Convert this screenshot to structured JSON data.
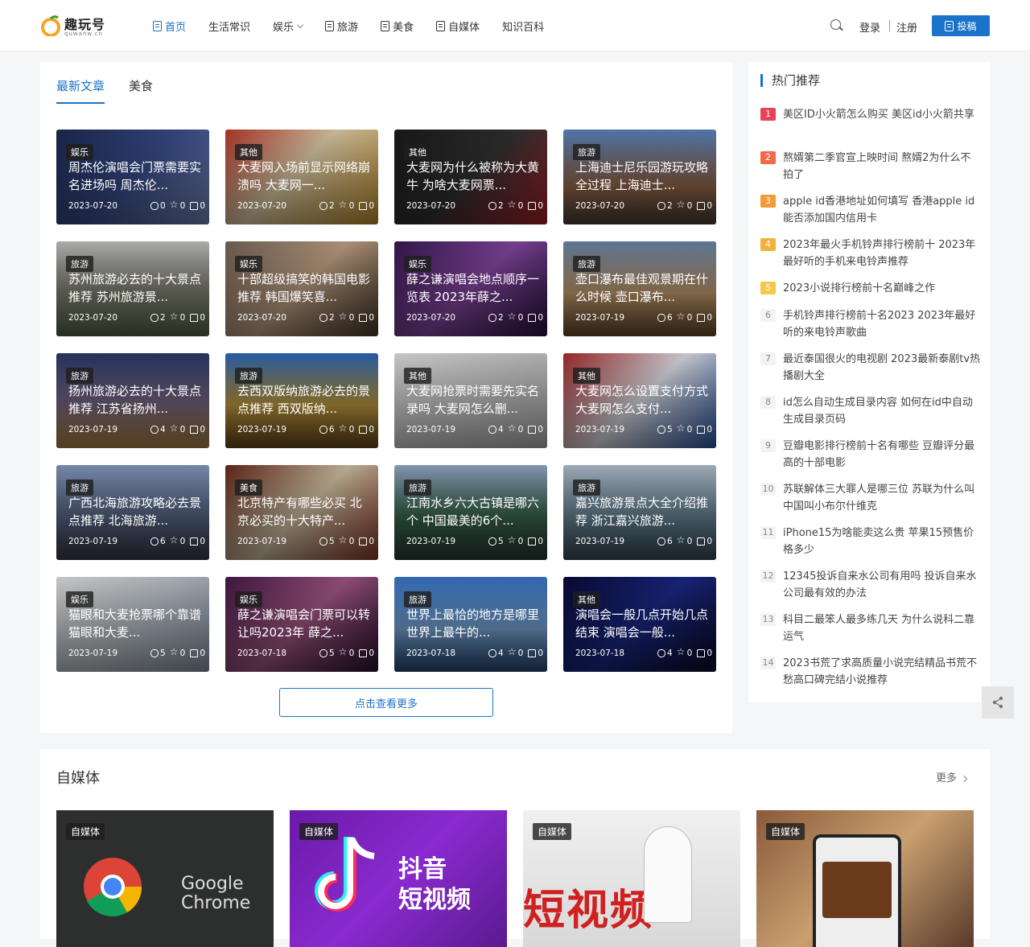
{
  "brand": {
    "name": "趣玩号",
    "domain": "quwanw.cn"
  },
  "nav": [
    {
      "label": "首页",
      "icon": "doc-icon",
      "active": true
    },
    {
      "label": "生活常识"
    },
    {
      "label": "娱乐",
      "dropdown": true
    },
    {
      "label": "旅游",
      "icon": "doc-icon"
    },
    {
      "label": "美食",
      "icon": "doc-icon"
    },
    {
      "label": "自媒体",
      "icon": "doc-icon"
    },
    {
      "label": "知识百科"
    }
  ],
  "header": {
    "login": "登录",
    "register": "注册",
    "post": "投稿"
  },
  "main": {
    "tabs": [
      "最新文章",
      "美食"
    ],
    "more_button": "点击查看更多",
    "cards": [
      {
        "cat": "娱乐",
        "title": "周杰伦演唱会门票需要实名进场吗 周杰伦...",
        "date": "2023-07-20",
        "views": "0",
        "stars": "0",
        "likes": "0",
        "bg": "linear-gradient(135deg,#1d2a55,#3a4f8f 50%,#7a8cc0)"
      },
      {
        "cat": "其他",
        "title": "大麦网入场前显示网络崩溃吗 大麦网一...",
        "date": "2023-07-20",
        "views": "2",
        "stars": "0",
        "likes": "0",
        "bg": "linear-gradient(135deg,#c23a2c,#e9d6b0 45%,#c5922e)"
      },
      {
        "cat": "其他",
        "title": "大麦网为什么被称为大黄牛 为啥大麦网票...",
        "date": "2023-07-20",
        "views": "2",
        "stars": "0",
        "likes": "0",
        "bg": "linear-gradient(135deg,#1b1b1b,#333 50%,#b1232c)"
      },
      {
        "cat": "旅游",
        "title": "上海迪士尼乐园游玩攻略全过程 上海迪士...",
        "date": "2023-07-20",
        "views": "2",
        "stars": "0",
        "likes": "0",
        "bg": "linear-gradient(180deg,#5a89c7,#9b6a4a 60%,#4a3e3a)"
      },
      {
        "cat": "旅游",
        "title": "苏州旅游必去的十大景点推荐 苏州旅游景...",
        "date": "2023-07-20",
        "views": "2",
        "stars": "0",
        "likes": "0",
        "bg": "linear-gradient(180deg,#c8c8c8,#8a8a7a 50%,#5a6a4a)"
      },
      {
        "cat": "娱乐",
        "title": "十部超级搞笑的韩国电影推荐 韩国爆笑喜...",
        "date": "2023-07-20",
        "views": "2",
        "stars": "0",
        "likes": "0",
        "bg": "linear-gradient(135deg,#7a6a5a,#c8a88a 50%,#4a3a2a)"
      },
      {
        "cat": "娱乐",
        "title": "薛之谦演唱会地点顺序一览表 2023年薛之...",
        "date": "2023-07-20",
        "views": "2",
        "stars": "0",
        "likes": "0",
        "bg": "linear-gradient(135deg,#3a1a55,#8a4aa8 50%,#2a1240)"
      },
      {
        "cat": "旅游",
        "title": "壶口瀑布最佳观景期在什么时候 壶口瀑布...",
        "date": "2023-07-19",
        "views": "6",
        "stars": "0",
        "likes": "0",
        "bg": "linear-gradient(180deg,#6a8ab0,#c8a070 55%,#6a4a2a)"
      },
      {
        "cat": "旅游",
        "title": "扬州旅游必去的十大景点推荐 江苏省扬州...",
        "date": "2023-07-19",
        "views": "4",
        "stars": "0",
        "likes": "0",
        "bg": "linear-gradient(180deg,#2a3a6a,#7a6a8a 50%,#b88a4a)"
      },
      {
        "cat": "旅游",
        "title": "去西双版纳旅游必去的景点推荐 西双版纳...",
        "date": "2023-07-19",
        "views": "6",
        "stars": "0",
        "likes": "0",
        "bg": "linear-gradient(180deg,#2a6ac0,#c8a040 55%,#6a4a1a)"
      },
      {
        "cat": "其他",
        "title": "大麦网抢票时需要先实名录吗 大麦网怎么删...",
        "date": "2023-07-19",
        "views": "4",
        "stars": "0",
        "likes": "0",
        "bg": "linear-gradient(135deg,#e8e8e8,#d0d0d0 50%,#b8b8b8)"
      },
      {
        "cat": "其他",
        "title": "大麦网怎么设置支付方式 大麦网怎么支付...",
        "date": "2023-07-19",
        "views": "5",
        "stars": "0",
        "likes": "0",
        "bg": "linear-gradient(135deg,#b02a2a,#e8e8f0 50%,#2a5aa8)"
      },
      {
        "cat": "旅游",
        "title": "广西北海旅游攻略必去景点推荐 北海旅游...",
        "date": "2023-07-19",
        "views": "6",
        "stars": "0",
        "likes": "0",
        "bg": "linear-gradient(180deg,#8aa0c8,#5a6a8a 55%,#3a3a4a)"
      },
      {
        "cat": "美食",
        "title": "北京特产有哪些必买 北京必买的十大特产...",
        "date": "2023-07-19",
        "views": "5",
        "stars": "0",
        "likes": "0",
        "bg": "linear-gradient(135deg,#6a2a1a,#d8c8a8 50%,#8a3a2a)"
      },
      {
        "cat": "旅游",
        "title": "江南水乡六大古镇是哪六个 中国最美的6个...",
        "date": "2023-07-19",
        "views": "5",
        "stars": "0",
        "likes": "0",
        "bg": "linear-gradient(180deg,#9ab0d0,#3a6a4a 55%,#2a3a3a)"
      },
      {
        "cat": "旅游",
        "title": "嘉兴旅游景点大全介绍推荐 浙江嘉兴旅游...",
        "date": "2023-07-19",
        "views": "6",
        "stars": "0",
        "likes": "0",
        "bg": "linear-gradient(180deg,#b8c8d8,#6a8a9a 55%,#3a4a5a)"
      },
      {
        "cat": "娱乐",
        "title": "猫眼和大麦抢票哪个靠谱 猫眼和大麦...",
        "date": "2023-07-19",
        "views": "5",
        "stars": "0",
        "likes": "0",
        "bg": "linear-gradient(135deg,#e8e8e8,#c0c8d0 50%,#8a9aa8)"
      },
      {
        "cat": "娱乐",
        "title": "薛之谦演唱会门票可以转让吗2023年 薛之...",
        "date": "2023-07-18",
        "views": "5",
        "stars": "0",
        "likes": "0",
        "bg": "linear-gradient(135deg,#4a1a4a,#a85a8a 50%,#2a1030)"
      },
      {
        "cat": "旅游",
        "title": "世界上最恰的地方是哪里 世界上最牛的...",
        "date": "2023-07-18",
        "views": "4",
        "stars": "0",
        "likes": "0",
        "bg": "linear-gradient(180deg,#3a7ad0,#7aa8d8 55%,#2a4a7a)"
      },
      {
        "cat": "其他",
        "title": "演唱会一般几点开始几点结束 演唱会一般...",
        "date": "2023-07-18",
        "views": "4",
        "stars": "0",
        "likes": "0",
        "bg": "linear-gradient(135deg,#0a0a3a,#1a2a8a 50%,#0a0a2a)"
      }
    ]
  },
  "sidebar": {
    "title": "热门推荐",
    "items": [
      {
        "num": "1",
        "text": "美区ID小火箭怎么购买 美区id小火箭共享",
        "color": "#e8415a"
      },
      {
        "num": "2",
        "text": "熬婿第二季官宣上映时间 熬婿2为什么不拍了",
        "color": "#f06a4a"
      },
      {
        "num": "3",
        "text": "apple id香港地址如何填写 香港apple id能否添加国内信用卡",
        "color": "#f59a3a"
      },
      {
        "num": "4",
        "text": "2023年最火手机铃声排行榜前十 2023年最好听的手机来电铃声推荐",
        "color": "#f5b23a"
      },
      {
        "num": "5",
        "text": "2023小说排行榜前十名巅峰之作",
        "color": "#f5c84a"
      },
      {
        "num": "6",
        "text": "手机铃声排行榜前十名2023 2023年最好听的来电铃声歌曲"
      },
      {
        "num": "7",
        "text": "最近泰国很火的电视剧 2023最新泰剧tv热播剧大全"
      },
      {
        "num": "8",
        "text": "id怎么自动生成目录内容 如何在id中自动生成目录页码"
      },
      {
        "num": "9",
        "text": "豆瓣电影排行榜前十名有哪些 豆瓣评分最高的十部电影"
      },
      {
        "num": "10",
        "text": "苏联解体三大罪人是哪三位 苏联为什么叫中国叫小布尔什维克"
      },
      {
        "num": "11",
        "text": "iPhone15为啥能卖这么贵 苹果15预售价格多少"
      },
      {
        "num": "12",
        "text": "12345投诉自来水公司有用吗 投诉自来水公司最有效的办法"
      },
      {
        "num": "13",
        "text": "科目二最笨人最多练几天 为什么说科二靠运气"
      },
      {
        "num": "14",
        "text": "2023书荒了求高质量小说完结精品书荒不愁高口碑完结小说推荐"
      }
    ]
  },
  "media": {
    "title": "自媒体",
    "more": "更多",
    "cards": [
      {
        "cat": "自媒体",
        "caption": "Google Chrome",
        "bg": "#2d2f2e"
      },
      {
        "cat": "自媒体",
        "caption": "抖音 短视频",
        "bg": "linear-gradient(135deg,#6a1aa8,#8a2ad0 50%,#5a1a90)"
      },
      {
        "cat": "自媒体",
        "caption": "短视频",
        "bg": "linear-gradient(180deg,#f0f0f0,#d8d8d8)"
      },
      {
        "cat": "自媒体",
        "caption": "",
        "bg": "linear-gradient(135deg,#8a5a3a,#c8a070 50%,#5a3a2a)"
      }
    ]
  }
}
